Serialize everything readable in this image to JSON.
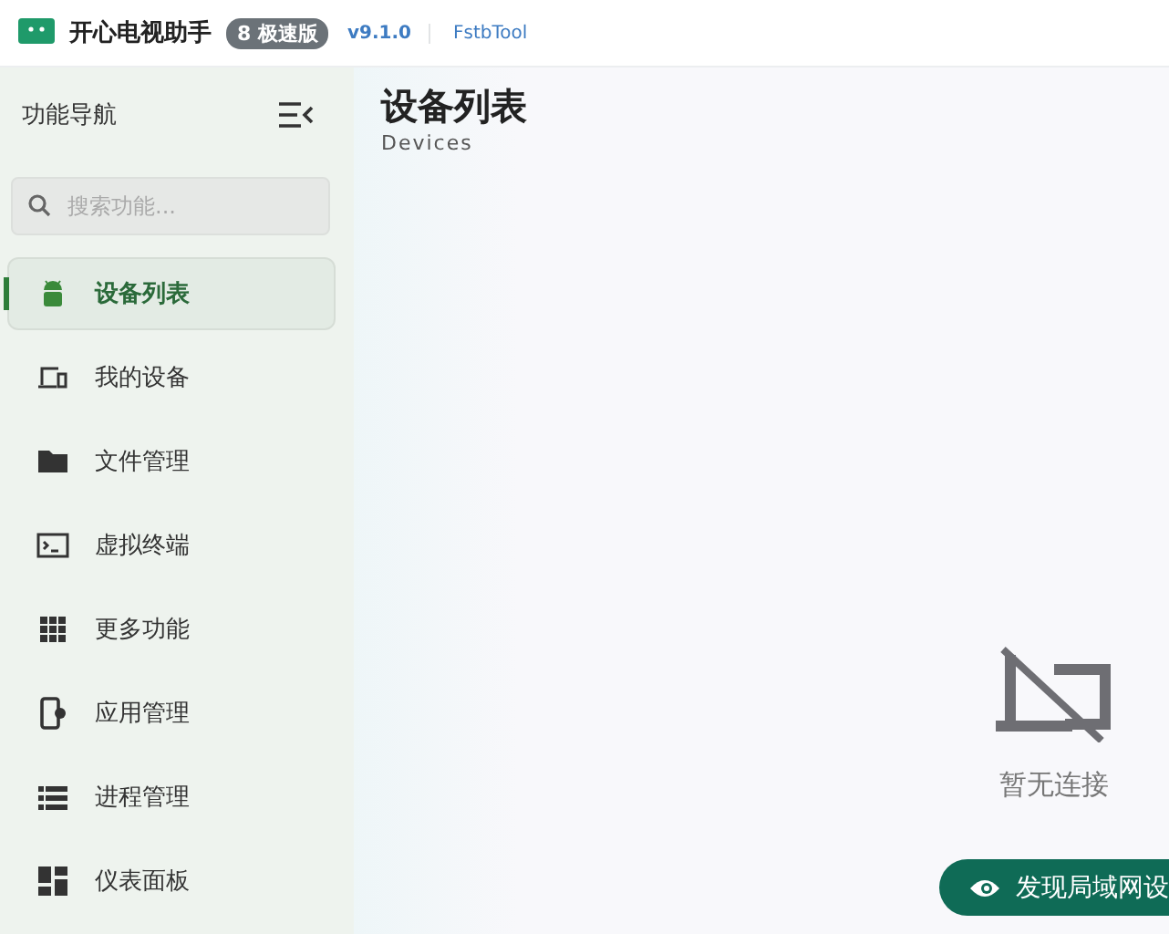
{
  "window": {
    "title": "开心电视助手",
    "edition_badge": "8 极速版",
    "version": "v9.1.0",
    "app_id": "FstbTool"
  },
  "sidebar": {
    "title": "功能导航",
    "search": {
      "placeholder": "搜索功能..."
    },
    "items": [
      {
        "label": "设备列表",
        "selected": true
      },
      {
        "label": "我的设备",
        "selected": false
      },
      {
        "label": "文件管理",
        "selected": false
      },
      {
        "label": "虚拟终端",
        "selected": false
      },
      {
        "label": "更多功能",
        "selected": false
      },
      {
        "label": "应用管理",
        "selected": false
      },
      {
        "label": "进程管理",
        "selected": false
      },
      {
        "label": "仪表面板",
        "selected": false
      }
    ]
  },
  "page": {
    "title": "设备列表",
    "subtitle": "Devices",
    "empty_text": "暂无连接",
    "discover_button": "发现局域网设"
  }
}
